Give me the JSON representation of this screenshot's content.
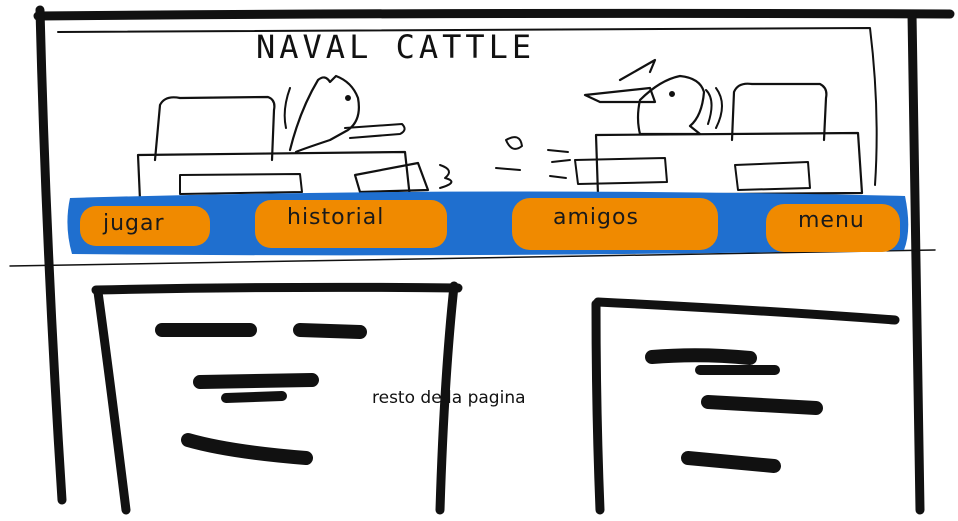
{
  "header": {
    "title": "NAVAL CATTLE"
  },
  "nav": {
    "items": [
      {
        "label": "jugar"
      },
      {
        "label": "historial"
      },
      {
        "label": "amigos"
      },
      {
        "label": "menu"
      }
    ]
  },
  "main": {
    "rest_label": "resto de la pagina"
  },
  "colors": {
    "nav_bar": "#1f6fcf",
    "nav_button": "#f08a00",
    "ink": "#111111"
  }
}
